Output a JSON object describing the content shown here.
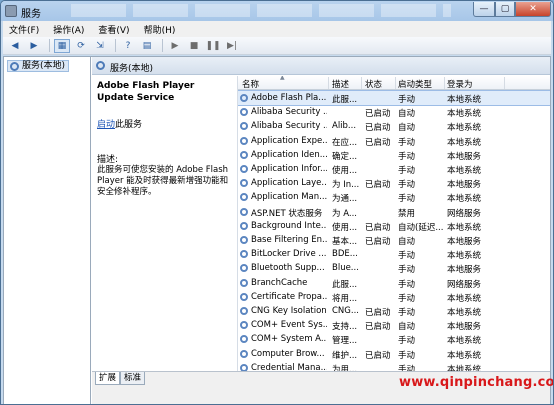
{
  "window": {
    "title": "服务"
  },
  "menu": [
    "文件(F)",
    "操作(A)",
    "查看(V)",
    "帮助(H)"
  ],
  "tree": {
    "root": "服务(本地)"
  },
  "header": {
    "title": "服务(本地)"
  },
  "description": {
    "service_name": "Adobe Flash Player Update Service",
    "start_link": "启动",
    "start_suffix": "此服务",
    "desc_label": "描述:",
    "desc_text": "此服务可使您安装的 Adobe Flash Player 能及时获得最新增强功能和安全修补程序。"
  },
  "columns": {
    "name": "名称",
    "desc": "描述",
    "status": "状态",
    "startup": "启动类型",
    "logon": "登录为"
  },
  "rows": [
    {
      "name": "Adobe Flash Pla...",
      "desc": "此服...",
      "status": "",
      "startup": "手动",
      "logon": "本地系统"
    },
    {
      "name": "Alibaba Security ...",
      "desc": "",
      "status": "已启动",
      "startup": "自动",
      "logon": "本地系统"
    },
    {
      "name": "Alibaba Security ...",
      "desc": "Alib...",
      "status": "已启动",
      "startup": "自动",
      "logon": "本地系统"
    },
    {
      "name": "Application Expe...",
      "desc": "在应...",
      "status": "已启动",
      "startup": "手动",
      "logon": "本地系统"
    },
    {
      "name": "Application Iden...",
      "desc": "确定...",
      "status": "",
      "startup": "手动",
      "logon": "本地服务"
    },
    {
      "name": "Application Infor...",
      "desc": "使用...",
      "status": "",
      "startup": "手动",
      "logon": "本地系统"
    },
    {
      "name": "Application Laye...",
      "desc": "为 In...",
      "status": "已启动",
      "startup": "手动",
      "logon": "本地服务"
    },
    {
      "name": "Application Man...",
      "desc": "为通...",
      "status": "",
      "startup": "手动",
      "logon": "本地系统"
    },
    {
      "name": "ASP.NET 状态服务",
      "desc": "为 A...",
      "status": "",
      "startup": "禁用",
      "logon": "网络服务"
    },
    {
      "name": "Background Inte...",
      "desc": "使用...",
      "status": "已启动",
      "startup": "自动(延迟...",
      "logon": "本地系统"
    },
    {
      "name": "Base Filtering En...",
      "desc": "基本...",
      "status": "已启动",
      "startup": "自动",
      "logon": "本地服务"
    },
    {
      "name": "BitLocker Drive ...",
      "desc": "BDE...",
      "status": "",
      "startup": "手动",
      "logon": "本地系统"
    },
    {
      "name": "Bluetooth Supp...",
      "desc": "Blue...",
      "status": "",
      "startup": "手动",
      "logon": "本地服务"
    },
    {
      "name": "BranchCache",
      "desc": "此服...",
      "status": "",
      "startup": "手动",
      "logon": "网络服务"
    },
    {
      "name": "Certificate Propa...",
      "desc": "将用...",
      "status": "",
      "startup": "手动",
      "logon": "本地系统"
    },
    {
      "name": "CNG Key Isolation",
      "desc": "CNG...",
      "status": "已启动",
      "startup": "手动",
      "logon": "本地系统"
    },
    {
      "name": "COM+ Event Sys...",
      "desc": "支持...",
      "status": "已启动",
      "startup": "自动",
      "logon": "本地服务"
    },
    {
      "name": "COM+ System A...",
      "desc": "管理...",
      "status": "",
      "startup": "手动",
      "logon": "本地系统"
    },
    {
      "name": "Computer Brow...",
      "desc": "维护...",
      "status": "已启动",
      "startup": "手动",
      "logon": "本地系统"
    },
    {
      "name": "Credential Mana...",
      "desc": "为用...",
      "status": "",
      "startup": "手动",
      "logon": "本地系统"
    }
  ],
  "tabs": [
    "扩展",
    "标准"
  ],
  "watermark": "www.qinpinchang.com"
}
